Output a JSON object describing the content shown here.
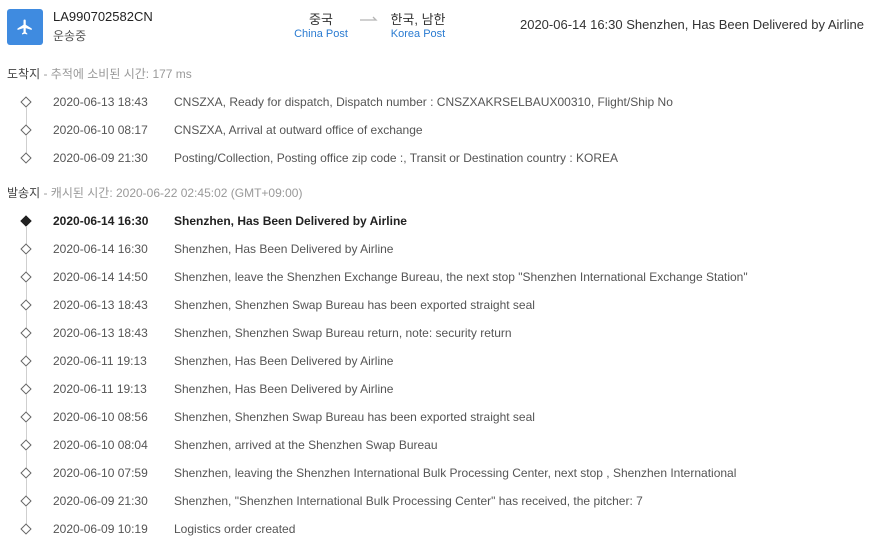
{
  "header": {
    "tracking_number": "LA990702582CN",
    "status": "운송중",
    "origin_country": "중국",
    "origin_carrier": "China Post",
    "destination_country": "한국, 남한",
    "destination_carrier": "Korea Post",
    "latest_event": "2020-06-14 16:30  Shenzhen, Has Been Delivered by Airline",
    "icon": "airplane-icon",
    "accent_color": "#3f8be0"
  },
  "destination_section": {
    "title": "도착지",
    "subtitle": " - 추적에 소비된 시간: 177 ms",
    "events": [
      {
        "date": "2020-06-13 18:43",
        "desc": "CNSZXA, Ready for dispatch, Dispatch number : CNSZXAKRSELBAUX00310, Flight/Ship No"
      },
      {
        "date": "2020-06-10 08:17",
        "desc": "CNSZXA, Arrival at outward office of exchange"
      },
      {
        "date": "2020-06-09 21:30",
        "desc": "Posting/Collection, Posting office zip code :, Transit or Destination country : KOREA"
      }
    ]
  },
  "origin_section": {
    "title": "발송지",
    "subtitle": " - 캐시된 시간: 2020-06-22 02:45:02 (GMT+09:00)",
    "events": [
      {
        "date": "2020-06-14 16:30",
        "desc": "Shenzhen, Has Been Delivered by Airline"
      },
      {
        "date": "2020-06-14 16:30",
        "desc": "Shenzhen, Has Been Delivered by Airline"
      },
      {
        "date": "2020-06-14 14:50",
        "desc": "Shenzhen, leave the Shenzhen Exchange Bureau, the next stop \"Shenzhen International Exchange Station\""
      },
      {
        "date": "2020-06-13 18:43",
        "desc": "Shenzhen, Shenzhen Swap Bureau has been exported straight seal"
      },
      {
        "date": "2020-06-13 18:43",
        "desc": "Shenzhen, Shenzhen Swap Bureau return, note: security return"
      },
      {
        "date": "2020-06-11 19:13",
        "desc": "Shenzhen, Has Been Delivered by Airline"
      },
      {
        "date": "2020-06-11 19:13",
        "desc": "Shenzhen, Has Been Delivered by Airline"
      },
      {
        "date": "2020-06-10 08:56",
        "desc": "Shenzhen, Shenzhen Swap Bureau has been exported straight seal"
      },
      {
        "date": "2020-06-10 08:04",
        "desc": "Shenzhen, arrived at the Shenzhen Swap Bureau"
      },
      {
        "date": "2020-06-10 07:59",
        "desc": "Shenzhen, leaving the Shenzhen International Bulk Processing Center, next stop , Shenzhen International"
      },
      {
        "date": "2020-06-09 21:30",
        "desc": "Shenzhen, \"Shenzhen International Bulk Processing Center\" has received, the pitcher: 7"
      },
      {
        "date": "2020-06-09 10:19",
        "desc": "Logistics order created"
      }
    ]
  }
}
